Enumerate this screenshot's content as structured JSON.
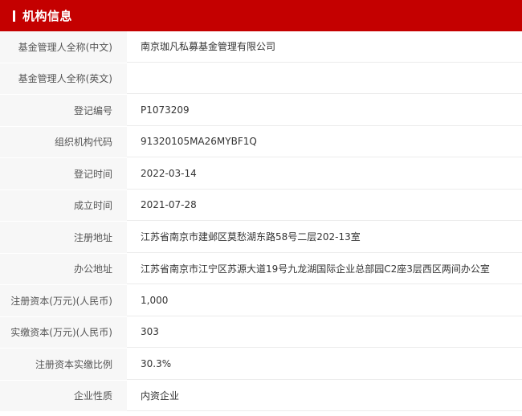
{
  "section": {
    "title": "机构信息"
  },
  "rows": [
    {
      "label": "基金管理人全称(中文)",
      "value": "南京珈凡私募基金管理有限公司"
    },
    {
      "label": "基金管理人全称(英文)",
      "value": ""
    },
    {
      "label": "登记编号",
      "value": "P1073209"
    },
    {
      "label": "组织机构代码",
      "value": "91320105MA26MYBF1Q"
    },
    {
      "label": "登记时间",
      "value": "2022-03-14"
    },
    {
      "label": "成立时间",
      "value": "2021-07-28"
    },
    {
      "label": "注册地址",
      "value": "江苏省南京市建邺区莫愁湖东路58号二层202-13室"
    },
    {
      "label": "办公地址",
      "value": "江苏省南京市江宁区苏源大道19号九龙湖国际企业总部园C2座3层西区两间办公室"
    },
    {
      "label": "注册资本(万元)(人民币)",
      "value": "1,000"
    },
    {
      "label": "实缴资本(万元)(人民币)",
      "value": "303"
    },
    {
      "label": "注册资本实缴比例",
      "value": "30.3%"
    },
    {
      "label": "企业性质",
      "value": "内资企业"
    }
  ]
}
